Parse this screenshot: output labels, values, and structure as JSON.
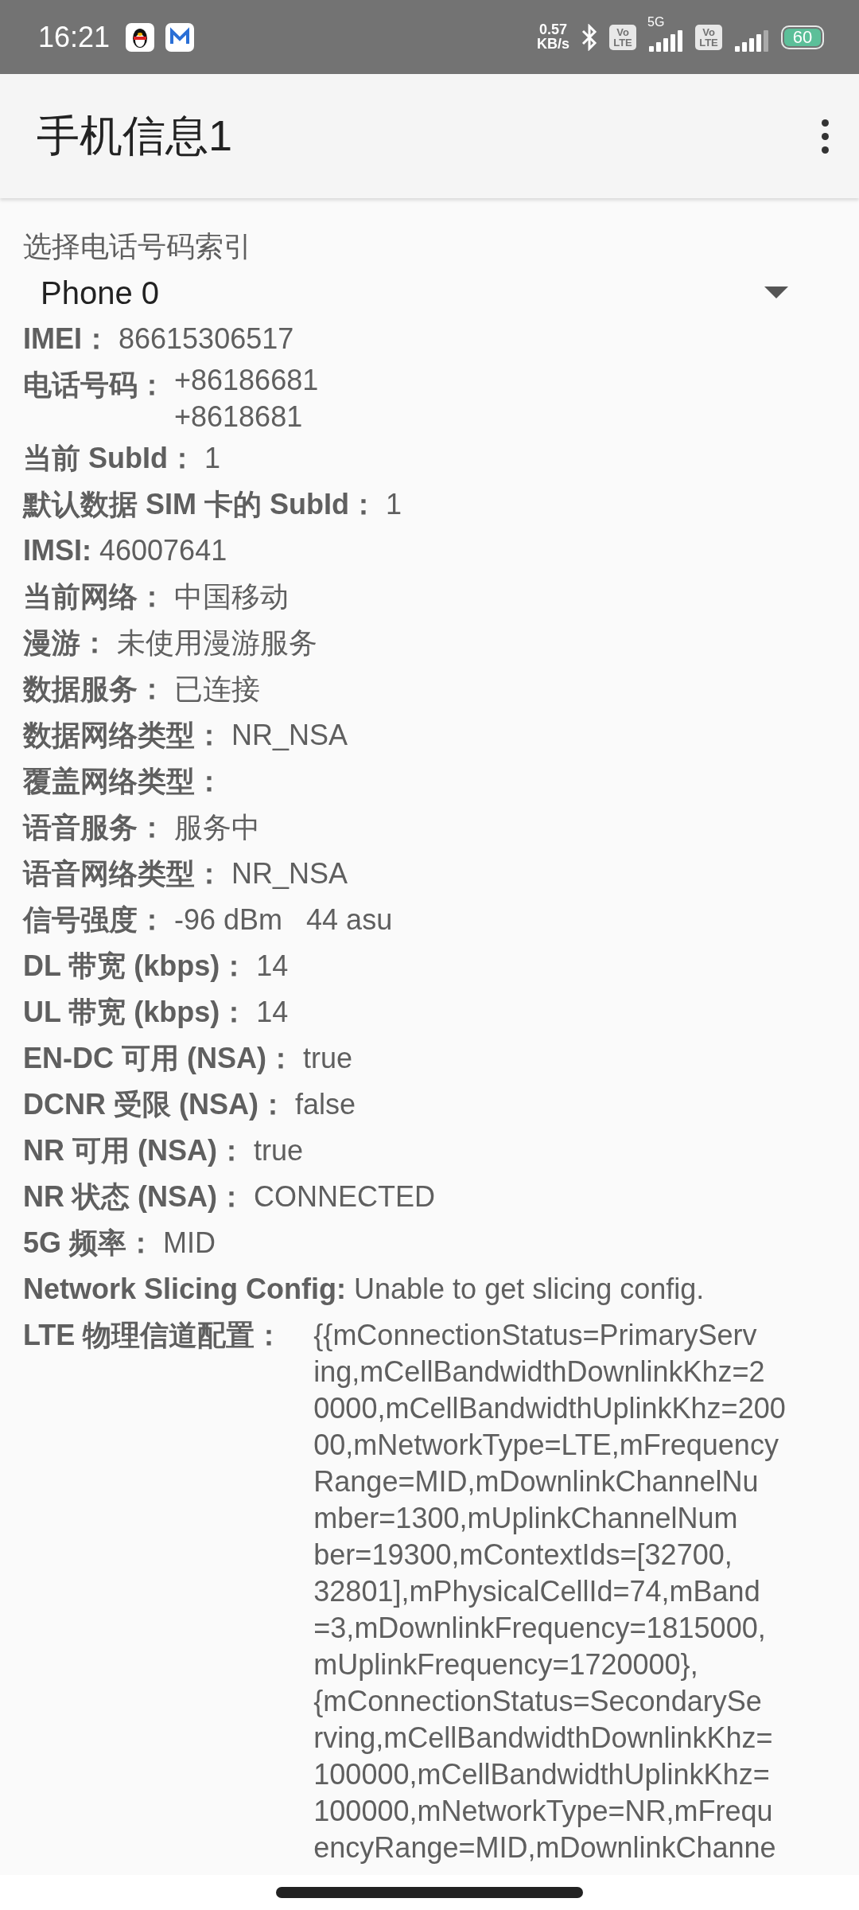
{
  "status_bar": {
    "time": "16:21",
    "speed_value": "0.57",
    "speed_unit": "KB/s",
    "sim_badges": [
      {
        "top": "Vo",
        "bottom": "LTE",
        "network": "5G"
      },
      {
        "top": "Vo",
        "bottom": "LTE"
      }
    ],
    "battery": "60"
  },
  "app_bar": {
    "title": "手机信息1"
  },
  "phone_selector": {
    "label": "选择电话号码索引",
    "value": "Phone 0"
  },
  "rows": [
    {
      "label": "IMEI：",
      "values": [
        "86615306517"
      ]
    },
    {
      "label": "电话号码：",
      "values": [
        "+86186681",
        "+8618681"
      ]
    },
    {
      "label": "当前 SubId：",
      "values": [
        "1"
      ]
    },
    {
      "label": "默认数据 SIM 卡的 SubId：",
      "values": [
        "1"
      ]
    },
    {
      "label": "IMSI:",
      "values": [
        "46007641"
      ]
    },
    {
      "label": "当前网络：",
      "values": [
        "中国移动"
      ]
    },
    {
      "label": "漫游：",
      "values": [
        "未使用漫游服务"
      ]
    },
    {
      "label": "数据服务：",
      "values": [
        "已连接"
      ]
    },
    {
      "label": "数据网络类型：",
      "values": [
        "NR_NSA"
      ]
    },
    {
      "label": "覆盖网络类型：",
      "values": []
    },
    {
      "label": "语音服务：",
      "values": [
        "服务中"
      ]
    },
    {
      "label": "语音网络类型：",
      "values": [
        "NR_NSA"
      ]
    },
    {
      "label": "信号强度：",
      "values": [
        "-96 dBm   44 asu"
      ]
    },
    {
      "label": "DL 带宽 (kbps)：",
      "values": [
        "14"
      ]
    },
    {
      "label": "UL 带宽 (kbps)：",
      "values": [
        "14"
      ]
    },
    {
      "label": "EN-DC 可用 (NSA)：",
      "values": [
        "true"
      ]
    },
    {
      "label": "DCNR 受限 (NSA)：",
      "values": [
        "false"
      ]
    },
    {
      "label": "NR 可用 (NSA)：",
      "values": [
        "true"
      ]
    },
    {
      "label": "NR 状态 (NSA)：",
      "values": [
        "CONNECTED"
      ]
    },
    {
      "label": "5G 频率：",
      "values": [
        "MID"
      ]
    },
    {
      "label": "Network Slicing Config:",
      "values": [
        "Unable to get slicing config."
      ]
    }
  ],
  "physical_channel": {
    "label": "LTE 物理信道配置：",
    "lines": [
      "{{mConnectionStatus=PrimaryServ",
      "ing,mCellBandwidthDownlinkKhz=2",
      "0000,mCellBandwidthUplinkKhz=200",
      "00,mNetworkType=LTE,mFrequency",
      "Range=MID,mDownlinkChannelNu",
      "mber=1300,mUplinkChannelNum",
      "ber=19300,mContextIds=[32700,",
      "32801],mPhysicalCellId=74,mBand",
      "=3,mDownlinkFrequency=1815000,",
      "mUplinkFrequency=1720000},",
      "{mConnectionStatus=SecondarySe",
      "rving,mCellBandwidthDownlinkKhz=",
      "100000,mCellBandwidthUplinkKhz=",
      "100000,mNetworkType=NR,mFrequ",
      "encyRange=MID,mDownlinkChanne"
    ]
  }
}
